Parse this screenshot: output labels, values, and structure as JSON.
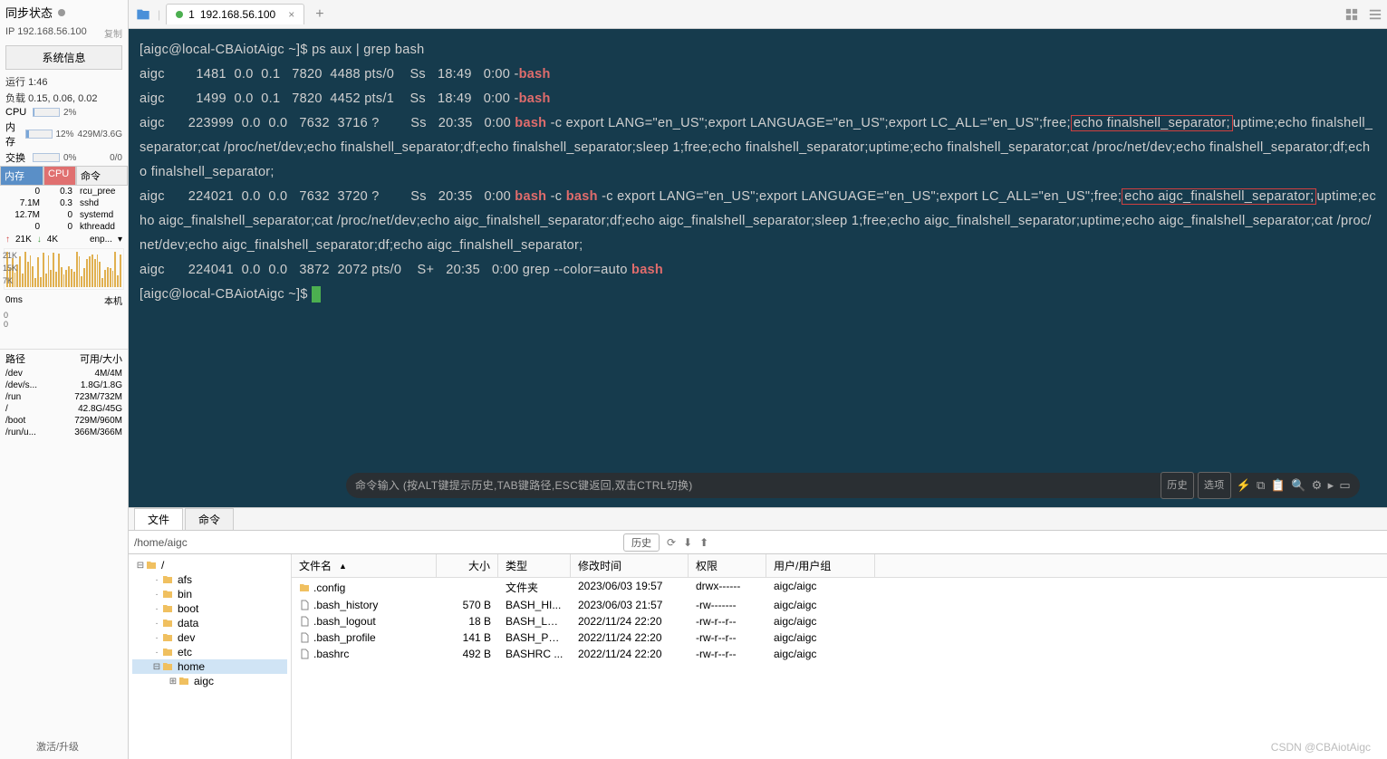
{
  "sidebar": {
    "sync_label": "同步状态",
    "ip_label": "IP",
    "ip_value": "192.168.56.100",
    "copy_label": "复制",
    "sys_info_btn": "系统信息",
    "runtime_label": "运行",
    "runtime_value": "1:46",
    "load_label": "负载",
    "load_value": "0.15, 0.06, 0.02",
    "metrics": [
      {
        "label": "CPU",
        "pct": "2%",
        "fill": 2,
        "right": ""
      },
      {
        "label": "内存",
        "pct": "12%",
        "fill": 12,
        "right": "429M/3.6G"
      },
      {
        "label": "交换",
        "pct": "0%",
        "fill": 0,
        "right": "0/0"
      }
    ],
    "proc_headers": {
      "mem": "内存",
      "cpu": "CPU",
      "cmd": "命令"
    },
    "processes": [
      {
        "mem": "0",
        "cpu": "0.3",
        "cmd": "rcu_pree"
      },
      {
        "mem": "7.1M",
        "cpu": "0.3",
        "cmd": "sshd"
      },
      {
        "mem": "12.7M",
        "cpu": "0",
        "cmd": "systemd"
      },
      {
        "mem": "0",
        "cpu": "0",
        "cmd": "kthreadd"
      }
    ],
    "net_up": "21K",
    "net_dn": "4K",
    "net_if": "enp...",
    "chart_y": [
      "21K",
      "15K",
      "7K"
    ],
    "chart2_y": [
      "0ms",
      "0",
      "0"
    ],
    "chart2_right": "本机",
    "disk_headers": {
      "path": "路径",
      "avail": "可用/大小"
    },
    "disks": [
      {
        "path": "/dev",
        "avail": "4M/4M"
      },
      {
        "path": "/dev/s...",
        "avail": "1.8G/1.8G"
      },
      {
        "path": "/run",
        "avail": "723M/732M"
      },
      {
        "path": "/",
        "avail": "42.8G/45G"
      },
      {
        "path": "/boot",
        "avail": "729M/960M"
      },
      {
        "path": "/run/u...",
        "avail": "366M/366M"
      }
    ],
    "activate": "激活/升级"
  },
  "tabbar": {
    "tab_index": "1",
    "tab_label": "192.168.56.100"
  },
  "terminal": {
    "prompt": "[aigc@local-CBAiotAigc ~]$ ",
    "cmd": "ps aux | grep bash",
    "line1a": "aigc        1481  0.0  0.1   7820  4488 pts/0    Ss   18:49   0:00 -",
    "line1b": "bash",
    "line2a": "aigc        1499  0.0  0.1   7820  4452 pts/1    Ss   18:49   0:00 -",
    "line2b": "bash",
    "line3a": "aigc      223999  0.0  0.0   7632  3716 ?        Ss   20:35   0:00 ",
    "line3b": "bash",
    "line3c": " -c export LANG=\"en_US\";export LANGUAGE=\"en_US\";export LC_ALL=\"en_US\";free;",
    "box1": "echo finalshell_separator;",
    "line3d": "uptime;echo finalshell_separator;cat /proc/net/dev;echo finalshell_separator;df;echo finalshell_separator;sleep 1;free;echo finalshell_separator;uptime;echo finalshell_separator;cat /proc/net/dev;echo finalshell_separator;df;echo finalshell_separator;",
    "line4a": "aigc      224021  0.0  0.0   7632  3720 ?        Ss   20:35   0:00 ",
    "line4b": "bash",
    "line4c": " -c ",
    "line4d": "bash",
    "line4e": " -c export LANG=\"en_US\";export LANGUAGE=\"en_US\";export LC_ALL=\"en_US\";free;",
    "box2": "echo aigc_finalshell_separator;",
    "line4f": "uptime;echo aigc_finalshell_separator;cat /proc/net/dev;echo aigc_finalshell_separator;df;echo aigc_finalshell_separator;sleep 1;free;echo aigc_finalshell_separator;uptime;echo aigc_finalshell_separator;cat /proc/net/dev;echo aigc_finalshell_separator;df;echo aigc_finalshell_separator;",
    "line5a": "aigc      224041  0.0  0.0   3872  2072 pts/0    S+   20:35   0:00 grep --color=auto ",
    "line5b": "bash"
  },
  "cmdbar": {
    "placeholder": "命令输入 (按ALT键提示历史,TAB键路径,ESC键返回,双击CTRL切换)",
    "history": "历史",
    "options": "选项"
  },
  "filetabs": {
    "files": "文件",
    "cmd": "命令"
  },
  "pathbar": {
    "path": "/home/aigc",
    "history": "历史"
  },
  "tree": [
    {
      "depth": 0,
      "exp": "⊟",
      "name": "/",
      "sel": false,
      "folder": true
    },
    {
      "depth": 1,
      "exp": "",
      "name": "afs",
      "folder": true
    },
    {
      "depth": 1,
      "exp": "",
      "name": "bin",
      "folder": true
    },
    {
      "depth": 1,
      "exp": "",
      "name": "boot",
      "folder": true
    },
    {
      "depth": 1,
      "exp": "",
      "name": "data",
      "folder": true
    },
    {
      "depth": 1,
      "exp": "",
      "name": "dev",
      "folder": true
    },
    {
      "depth": 1,
      "exp": "",
      "name": "etc",
      "folder": true
    },
    {
      "depth": 1,
      "exp": "⊟",
      "name": "home",
      "sel": true,
      "folder": true
    },
    {
      "depth": 2,
      "exp": "⊞",
      "name": "aigc",
      "folder": true
    }
  ],
  "filelist": {
    "headers": {
      "name": "文件名",
      "size": "大小",
      "type": "类型",
      "date": "修改时间",
      "perm": "权限",
      "owner": "用户/用户组"
    },
    "rows": [
      {
        "icon": "folder",
        "name": ".config",
        "size": "",
        "type": "文件夹",
        "date": "2023/06/03 19:57",
        "perm": "drwx------",
        "owner": "aigc/aigc"
      },
      {
        "icon": "file",
        "name": ".bash_history",
        "size": "570 B",
        "type": "BASH_HI...",
        "date": "2023/06/03 21:57",
        "perm": "-rw-------",
        "owner": "aigc/aigc"
      },
      {
        "icon": "file",
        "name": ".bash_logout",
        "size": "18 B",
        "type": "BASH_LO...",
        "date": "2022/11/24 22:20",
        "perm": "-rw-r--r--",
        "owner": "aigc/aigc"
      },
      {
        "icon": "file",
        "name": ".bash_profile",
        "size": "141 B",
        "type": "BASH_PR...",
        "date": "2022/11/24 22:20",
        "perm": "-rw-r--r--",
        "owner": "aigc/aigc"
      },
      {
        "icon": "file",
        "name": ".bashrc",
        "size": "492 B",
        "type": "BASHRC ...",
        "date": "2022/11/24 22:20",
        "perm": "-rw-r--r--",
        "owner": "aigc/aigc"
      }
    ]
  },
  "watermark": "CSDN @CBAiotAigc"
}
